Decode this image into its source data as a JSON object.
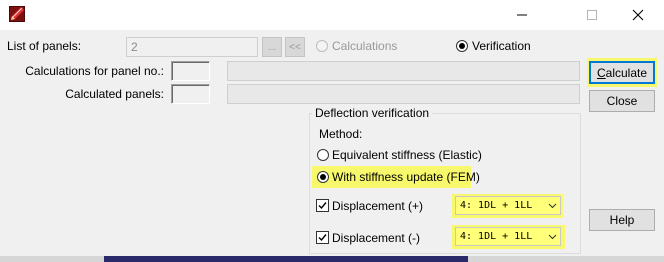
{
  "window": {
    "title": "",
    "minimize_glyph": "—",
    "maximize_glyph": "☐",
    "close_glyph": "✕"
  },
  "panels": {
    "list_label": "List of panels:",
    "list_value": "2",
    "browse_label": "...",
    "back_label": "<<",
    "calculations_label": "Calculations",
    "verification_label": "Verification",
    "mode": "Verification",
    "calc_for_panel_label": "Calculations for panel no.:",
    "calculated_panels_label": "Calculated panels:"
  },
  "deflection": {
    "group_title": "Deflection verification",
    "method_label": "Method:",
    "option_elastic": "Equivalent stiffness (Elastic)",
    "option_fem": "With stiffness update (FEM)",
    "selected_method": "FEM",
    "disp_plus_label": "Displacement (+)",
    "disp_plus_checked": true,
    "disp_plus_value": "4: 1DL + 1LL",
    "disp_minus_label": "Displacement (-)",
    "disp_minus_checked": true,
    "disp_minus_value": "4: 1DL + 1LL"
  },
  "buttons": {
    "calculate": "Calculate",
    "calculate_accel": "C",
    "calculate_rest": "alculate",
    "close": "Close",
    "help": "Help"
  },
  "colors": {
    "highlight": "#ffff00",
    "focus_border": "#0078d7",
    "dialog_bg": "#f0f0f0"
  },
  "icons": {
    "app": "red-pencil-icon",
    "dropdown": "chevron-down-icon"
  }
}
